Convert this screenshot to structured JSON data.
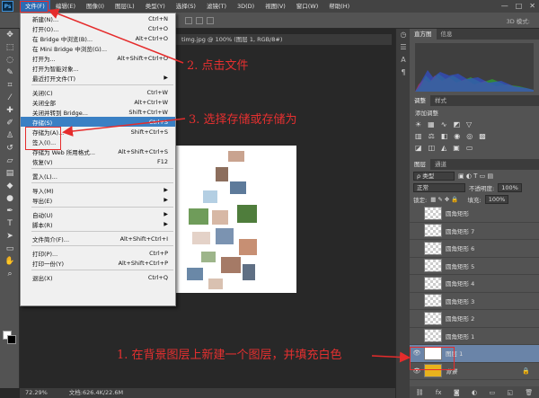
{
  "app": {
    "logo": "Ps",
    "doc_title": "timg.jpg @ 100% (图层 1, RGB/8#)"
  },
  "menubar": {
    "items": [
      "文件(F)",
      "编辑(E)",
      "图像(I)",
      "图层(L)",
      "类型(Y)",
      "选择(S)",
      "滤镜(T)",
      "3D(D)",
      "视图(V)",
      "窗口(W)",
      "帮助(H)"
    ],
    "active_index": 0,
    "window_controls": [
      "—",
      "□",
      "✕"
    ]
  },
  "optbar": {
    "mode3d": "3D 模式:"
  },
  "file_menu": {
    "groups": [
      [
        {
          "label": "新建(N)...",
          "shortcut": "Ctrl+N"
        },
        {
          "label": "打开(O)...",
          "shortcut": "Ctrl+O"
        },
        {
          "label": "在 Bridge 中浏览(B)...",
          "shortcut": "Alt+Ctrl+O"
        },
        {
          "label": "在 Mini Bridge 中浏览(G)...",
          "shortcut": ""
        },
        {
          "label": "打开为...",
          "shortcut": "Alt+Shift+Ctrl+O"
        },
        {
          "label": "打开为智能对象...",
          "shortcut": ""
        },
        {
          "label": "最近打开文件(T)",
          "shortcut": "",
          "submenu": true
        }
      ],
      [
        {
          "label": "关闭(C)",
          "shortcut": "Ctrl+W"
        },
        {
          "label": "关闭全部",
          "shortcut": "Alt+Ctrl+W"
        },
        {
          "label": "关闭并转到 Bridge...",
          "shortcut": "Shift+Ctrl+W"
        },
        {
          "label": "存储(S)",
          "shortcut": "Ctrl+S",
          "highlight": true
        },
        {
          "label": "存储为(A)...",
          "shortcut": "Shift+Ctrl+S"
        },
        {
          "label": "签入(I)...",
          "shortcut": ""
        },
        {
          "label": "存储为 Web 所用格式...",
          "shortcut": "Alt+Shift+Ctrl+S"
        },
        {
          "label": "恢复(V)",
          "shortcut": "F12"
        }
      ],
      [
        {
          "label": "置入(L)...",
          "shortcut": ""
        }
      ],
      [
        {
          "label": "导入(M)",
          "shortcut": "",
          "submenu": true
        },
        {
          "label": "导出(E)",
          "shortcut": "",
          "submenu": true
        }
      ],
      [
        {
          "label": "自动(U)",
          "shortcut": "",
          "submenu": true
        },
        {
          "label": "脚本(R)",
          "shortcut": "",
          "submenu": true
        }
      ],
      [
        {
          "label": "文件简介(F)...",
          "shortcut": "Alt+Shift+Ctrl+I"
        }
      ],
      [
        {
          "label": "打印(P)...",
          "shortcut": "Ctrl+P"
        },
        {
          "label": "打印一份(Y)",
          "shortcut": "Alt+Shift+Ctrl+P"
        }
      ],
      [
        {
          "label": "退出(X)",
          "shortcut": "Ctrl+Q"
        }
      ]
    ]
  },
  "panels": {
    "histogram_tabs": [
      "直方图",
      "信息"
    ],
    "adjust_tabs": [
      "调整",
      "样式"
    ],
    "adjust_title": "添加调整",
    "layers_tabs": [
      "图层",
      "通道"
    ],
    "kind_label": "ρ 类型",
    "blend_mode": "正常",
    "opacity_label": "不透明度:",
    "opacity_value": "100%",
    "lock_label": "锁定:",
    "fill_label": "填充:",
    "fill_value": "100%",
    "layers": [
      {
        "name": "圆角矩形",
        "visible": false,
        "thumb": "checker"
      },
      {
        "name": "圆角矩形 7",
        "visible": false,
        "thumb": "checker"
      },
      {
        "name": "圆角矩形 6",
        "visible": false,
        "thumb": "checker"
      },
      {
        "name": "圆角矩形 5",
        "visible": false,
        "thumb": "checker"
      },
      {
        "name": "圆角矩形 4",
        "visible": false,
        "thumb": "checker"
      },
      {
        "name": "圆角矩形 3",
        "visible": false,
        "thumb": "checker"
      },
      {
        "name": "圆角矩形 2",
        "visible": false,
        "thumb": "checker"
      },
      {
        "name": "圆角矩形 1",
        "visible": false,
        "thumb": "checker"
      },
      {
        "name": "图层 1",
        "visible": true,
        "thumb": "white",
        "selected": true
      },
      {
        "name": "背景",
        "visible": true,
        "thumb": "bg",
        "locked": true
      }
    ]
  },
  "status": {
    "zoom": "72.29%",
    "doc_size": "文档:626.4K/22.6M"
  },
  "annotations": {
    "step1": "1. 在背景图层上新建一个图层，并填充白色",
    "step2": "2. 点击文件",
    "step3": "3. 选择存储或存储为"
  },
  "colors": {
    "accent": "#3a80c4",
    "annotation": "#e52c2c",
    "selected_layer": "#6a84a8"
  }
}
